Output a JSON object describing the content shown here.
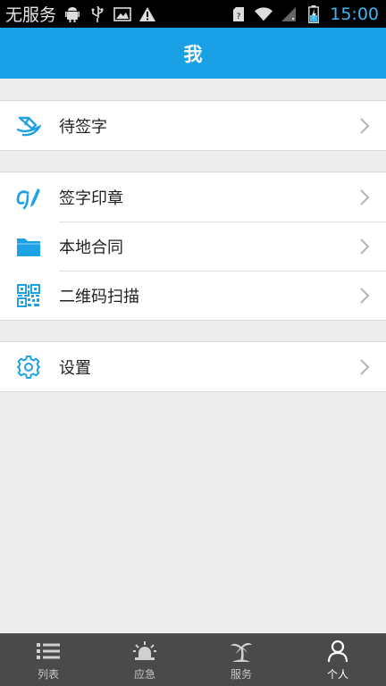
{
  "status_bar": {
    "carrier": "无服务",
    "time": "15:00",
    "icons": [
      "android-icon",
      "usb-icon",
      "image-icon",
      "warning-icon",
      "sim-icon",
      "wifi-icon",
      "signal-icon",
      "battery-icon"
    ]
  },
  "header": {
    "title": "我"
  },
  "menu": {
    "group1": [
      {
        "label": "待签字",
        "icon": "pen-sign-icon"
      }
    ],
    "group2": [
      {
        "label": "签字印章",
        "icon": "signature-icon"
      },
      {
        "label": "本地合同",
        "icon": "folder-icon"
      },
      {
        "label": "二维码扫描",
        "icon": "qrcode-icon"
      }
    ],
    "group3": [
      {
        "label": "设置",
        "icon": "gear-icon"
      }
    ]
  },
  "bottom_nav": {
    "items": [
      {
        "label": "列表",
        "icon": "list-icon"
      },
      {
        "label": "应急",
        "icon": "alarm-icon"
      },
      {
        "label": "服务",
        "icon": "palm-tree-icon"
      },
      {
        "label": "个人",
        "icon": "person-icon",
        "active": true
      }
    ]
  },
  "colors": {
    "accent": "#1aa0e4",
    "icon_blue": "#1ea2e6",
    "background": "#ededed",
    "nav_background": "#4a4a4a"
  }
}
